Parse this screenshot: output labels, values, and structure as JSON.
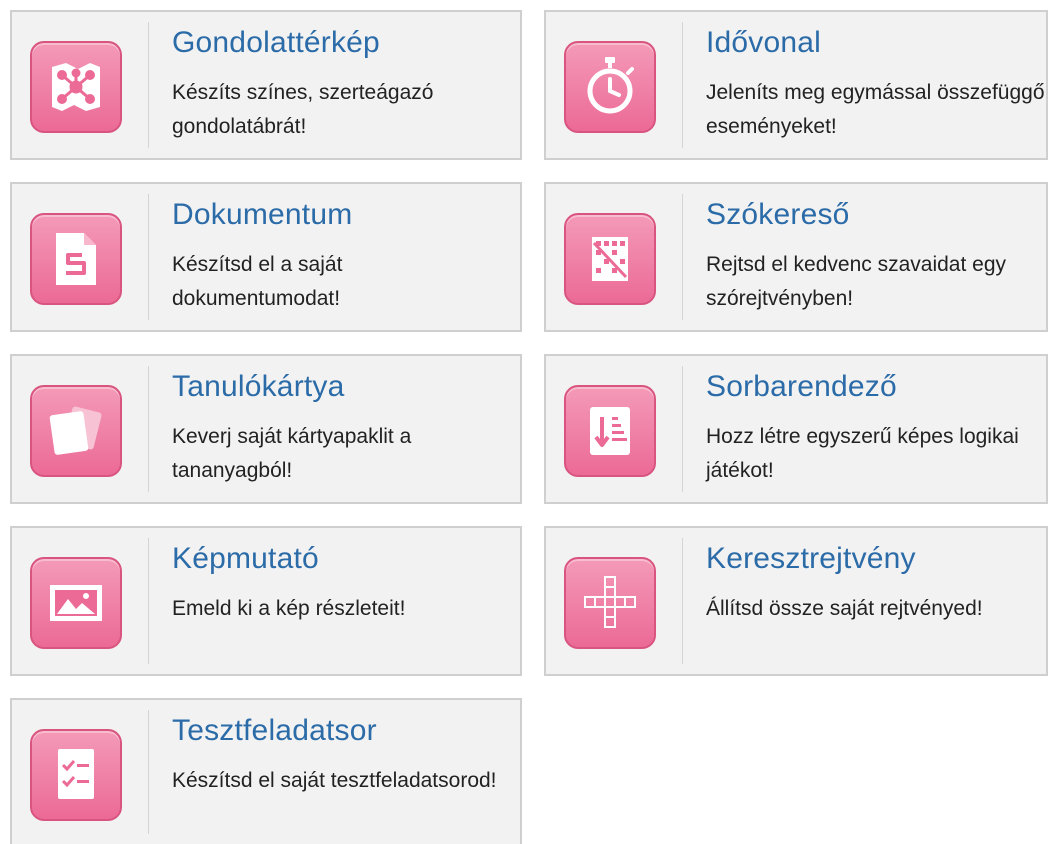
{
  "accent_color": "#eb6a96",
  "title_color": "#2b6ba8",
  "cards": [
    {
      "title": "Gondolattérkép",
      "description": "Készíts színes, szerteágazó gondolatábrát!",
      "icon": "mindmap-icon"
    },
    {
      "title": "Idővonal",
      "description": "Jeleníts meg egymással összefüggő eseményeket!",
      "icon": "stopwatch-icon"
    },
    {
      "title": "Dokumentum",
      "description": "Készítsd el a saját dokumentumodat!",
      "icon": "document-icon"
    },
    {
      "title": "Szókereső",
      "description": "Rejtsd el kedvenc szavaidat egy szórejtvényben!",
      "icon": "word-search-icon"
    },
    {
      "title": "Tanulókártya",
      "description": "Keverj saját kártyapaklit a tananyagból!",
      "icon": "flashcards-icon"
    },
    {
      "title": "Sorbarendező",
      "description": "Hozz létre egyszerű képes logikai játékot!",
      "icon": "sort-icon"
    },
    {
      "title": "Képmutató",
      "description": "Emeld ki a kép részleteit!",
      "icon": "image-viewer-icon"
    },
    {
      "title": "Keresztrejtvény",
      "description": "Állítsd össze saját rejtvényed!",
      "icon": "crossword-icon"
    },
    {
      "title": "Tesztfeladatsor",
      "description": "Készítsd el saját tesztfeladatsorod!",
      "icon": "quiz-checklist-icon"
    }
  ]
}
